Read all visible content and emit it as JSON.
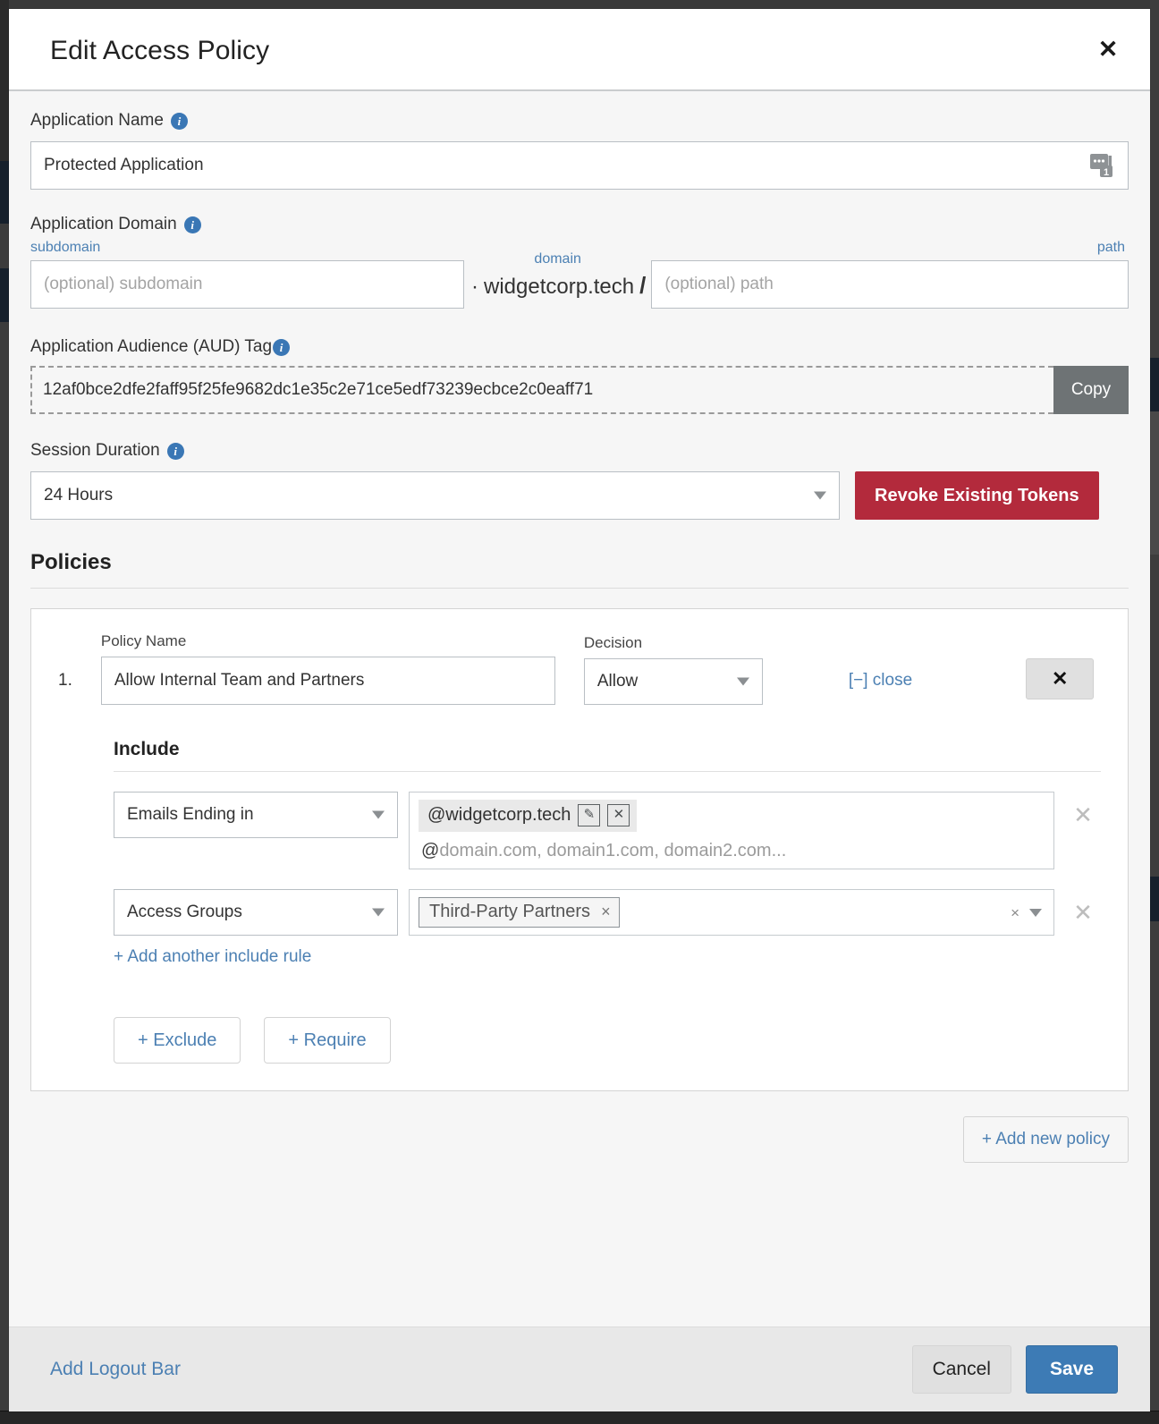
{
  "background": {
    "note": "dark page behind modal"
  },
  "modal": {
    "title": "Edit Access Policy",
    "close_icon": "close-icon"
  },
  "form": {
    "application_name": {
      "label": "Application Name",
      "value": "Protected Application",
      "logo_icon": "app-logo-icon"
    },
    "application_domain": {
      "label": "Application Domain",
      "subdomain_label": "subdomain",
      "subdomain_placeholder": "(optional) subdomain",
      "subdomain_value": "",
      "domain_label": "domain",
      "domain_separator_dot": "·",
      "domain_value": "widgetcorp.tech",
      "domain_separator_slash": "/",
      "path_label": "path",
      "path_placeholder": "(optional) path",
      "path_value": ""
    },
    "aud_tag": {
      "label": "Application Audience (AUD) Tag",
      "value": "12af0bce2dfe2faff95f25fe9682dc1e35c2e71ce5edf73239ecbce2c0eaff71",
      "copy_label": "Copy"
    },
    "session_duration": {
      "label": "Session Duration",
      "value": "24 Hours",
      "revoke_label": "Revoke Existing Tokens"
    }
  },
  "policies": {
    "heading": "Policies",
    "add_new_label": "+ Add new policy",
    "items": [
      {
        "index": "1.",
        "name_label": "Policy Name",
        "name_value": "Allow Internal Team and Partners",
        "decision_label": "Decision",
        "decision_value": "Allow",
        "close_link": "[−] close",
        "remove_icon": "close-icon",
        "include_heading": "Include",
        "rules": [
          {
            "selector": "Emails Ending in",
            "token": "@widgetcorp.tech",
            "edit_icon": "pencil-icon",
            "delete_icon": "close-box-icon",
            "hint_at": "@",
            "hint_rest": "domain.com, domain1.com, domain2.com...",
            "remove_icon": "close-icon"
          },
          {
            "selector": "Access Groups",
            "token": "Third-Party Partners",
            "token_x": "×",
            "clear_icon": "×",
            "caret_icon": "chevron-down-icon",
            "remove_icon": "close-icon"
          }
        ],
        "add_rule_label": "+ Add another include rule",
        "exclude_label": "+ Exclude",
        "require_label": "+ Require"
      }
    ]
  },
  "footer": {
    "logout_bar_label": "Add Logout Bar",
    "cancel_label": "Cancel",
    "save_label": "Save"
  },
  "colors": {
    "accent_blue": "#4c80b3",
    "danger_red": "#b32a3c",
    "save_blue": "#3d7bb5",
    "info_blue": "#3a77b5",
    "copy_gray": "#6e7375"
  }
}
